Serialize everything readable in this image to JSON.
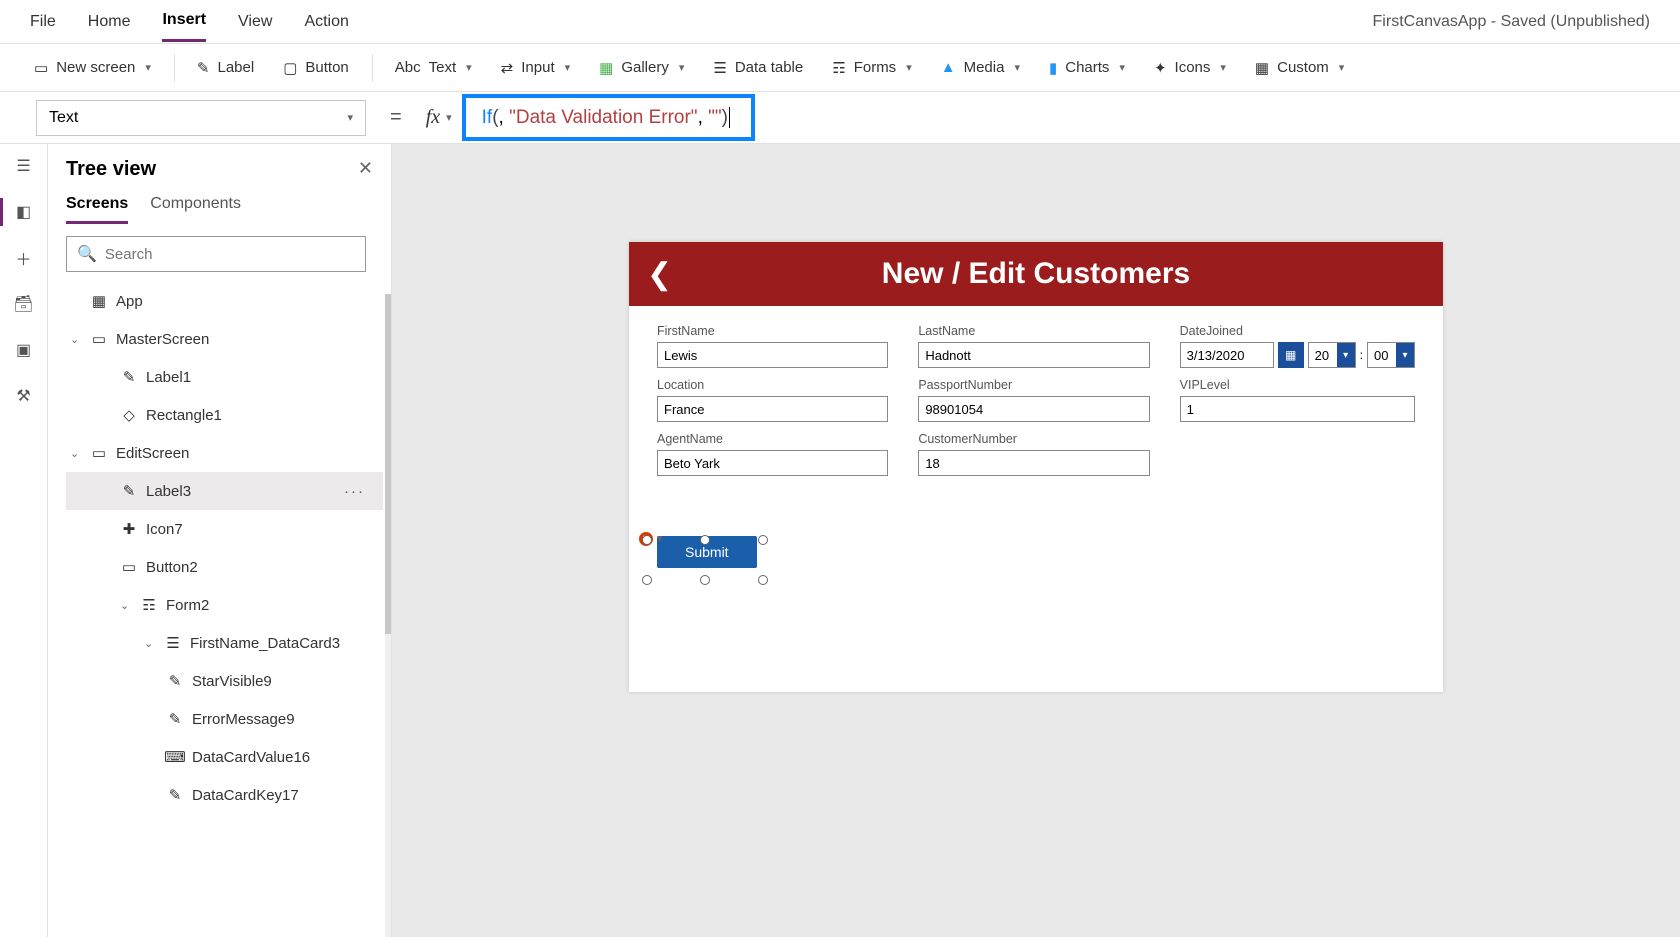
{
  "app_title": "FirstCanvasApp - Saved (Unpublished)",
  "menu": {
    "file": "File",
    "home": "Home",
    "insert": "Insert",
    "view": "View",
    "action": "Action"
  },
  "ribbon": {
    "new_screen": "New screen",
    "label": "Label",
    "button": "Button",
    "text": "Text",
    "input": "Input",
    "gallery": "Gallery",
    "datatable": "Data table",
    "forms": "Forms",
    "media": "Media",
    "charts": "Charts",
    "icons": "Icons",
    "custom": "Custom"
  },
  "property_selector": "Text",
  "formula": {
    "fn": "If",
    "arg1": ", ",
    "arg2": "\"Data Validation Error\"",
    "arg3": ", ",
    "arg4": "\"\""
  },
  "tree": {
    "title": "Tree view",
    "tabs": {
      "screens": "Screens",
      "components": "Components"
    },
    "search_placeholder": "Search",
    "items": [
      {
        "label": "App",
        "icon": "app"
      },
      {
        "label": "MasterScreen",
        "icon": "screen",
        "expand": true
      },
      {
        "label": "Label1",
        "icon": "label",
        "indent": 2
      },
      {
        "label": "Rectangle1",
        "icon": "rect",
        "indent": 2
      },
      {
        "label": "EditScreen",
        "icon": "screen",
        "expand": true
      },
      {
        "label": "Label3",
        "icon": "label",
        "indent": 2,
        "selected": true
      },
      {
        "label": "Icon7",
        "icon": "iconctrl",
        "indent": 2
      },
      {
        "label": "Button2",
        "icon": "buttonctrl",
        "indent": 2
      },
      {
        "label": "Form2",
        "icon": "form",
        "indent": 2,
        "expand": true
      },
      {
        "label": "FirstName_DataCard3",
        "icon": "datacard",
        "indent": 3,
        "expand": true
      },
      {
        "label": "StarVisible9",
        "icon": "label",
        "indent": 4
      },
      {
        "label": "ErrorMessage9",
        "icon": "label",
        "indent": 4
      },
      {
        "label": "DataCardValue16",
        "icon": "textinput",
        "indent": 4
      },
      {
        "label": "DataCardKey17",
        "icon": "label",
        "indent": 4
      }
    ]
  },
  "form": {
    "title": "New / Edit Customers",
    "fields": {
      "firstname": {
        "label": "FirstName",
        "value": "Lewis"
      },
      "lastname": {
        "label": "LastName",
        "value": "Hadnott"
      },
      "datejoined": {
        "label": "DateJoined",
        "value": "3/13/2020",
        "hour": "20",
        "minute": "00"
      },
      "location": {
        "label": "Location",
        "value": "France"
      },
      "passport": {
        "label": "PassportNumber",
        "value": "98901054"
      },
      "vip": {
        "label": "VIPLevel",
        "value": "1"
      },
      "agent": {
        "label": "AgentName",
        "value": "Beto Yark"
      },
      "custnum": {
        "label": "CustomerNumber",
        "value": "18"
      }
    },
    "submit": "Submit"
  }
}
